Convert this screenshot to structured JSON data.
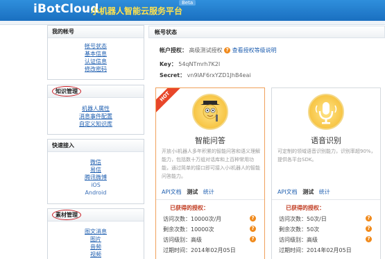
{
  "header": {
    "logo": "iBotCloud",
    "slogan": "小机器人智能云服务平台",
    "beta": "Beta"
  },
  "sidebar": {
    "sections": [
      {
        "title": "我的帐号",
        "items": [
          "帐号状态",
          "基本信息",
          "认证信息",
          "修改密码"
        ]
      },
      {
        "title": "知识管理",
        "items": [
          "机器人属性",
          "消息事件配置",
          "自定义知识库"
        ]
      },
      {
        "title": "快速接入",
        "items": [
          "微信",
          "易信",
          "腾讯微博",
          "iOS",
          "Android"
        ]
      },
      {
        "title": "素材管理",
        "items": [
          "图文消息",
          "图片",
          "音频",
          "视频"
        ]
      }
    ]
  },
  "main": {
    "title": "帐号状态",
    "auth_label": "帐户授权：",
    "auth_value": "高级测试授权",
    "auth_link": "查看授权等级说明",
    "key_label": "Key：",
    "key_value": "54qNTmrh7K2I",
    "secret_label": "Secret：",
    "secret_value": "vn9IAF6rxYZD1JhB4eai"
  },
  "cards": [
    {
      "hot": "HOT",
      "title": "智能问答",
      "desc": "开放小i机器人多年积累的智能问答和语义理解能力，包括数十万组对话库和上百种常用功能，通过简单的接口即可接入小i机器人的智能问答能力。",
      "link_doc": "API文档",
      "link_test": "测试",
      "link_stat": "统计",
      "granted": "已获得的授权：",
      "rows": [
        "访问次数：10000次/月",
        "剩余次数：10000次",
        "访问级别：高级",
        "过期时间：2014年02月05日"
      ]
    },
    {
      "title": "语音识别",
      "desc": "可定制的领域语音识别能力，识别率超90%，提供各平台SDK。",
      "link_doc": "API文档",
      "link_test": "测试",
      "link_stat": "统计",
      "granted": "已获得的授权：",
      "rows": [
        "访问次数：50次/日",
        "剩余次数：50次",
        "访问级别：高级",
        "过期时间：2014年02月05日"
      ]
    }
  ],
  "icons": {
    "help": "?",
    "accent": "#f08a1c",
    "brand": "#1a6fc0"
  }
}
